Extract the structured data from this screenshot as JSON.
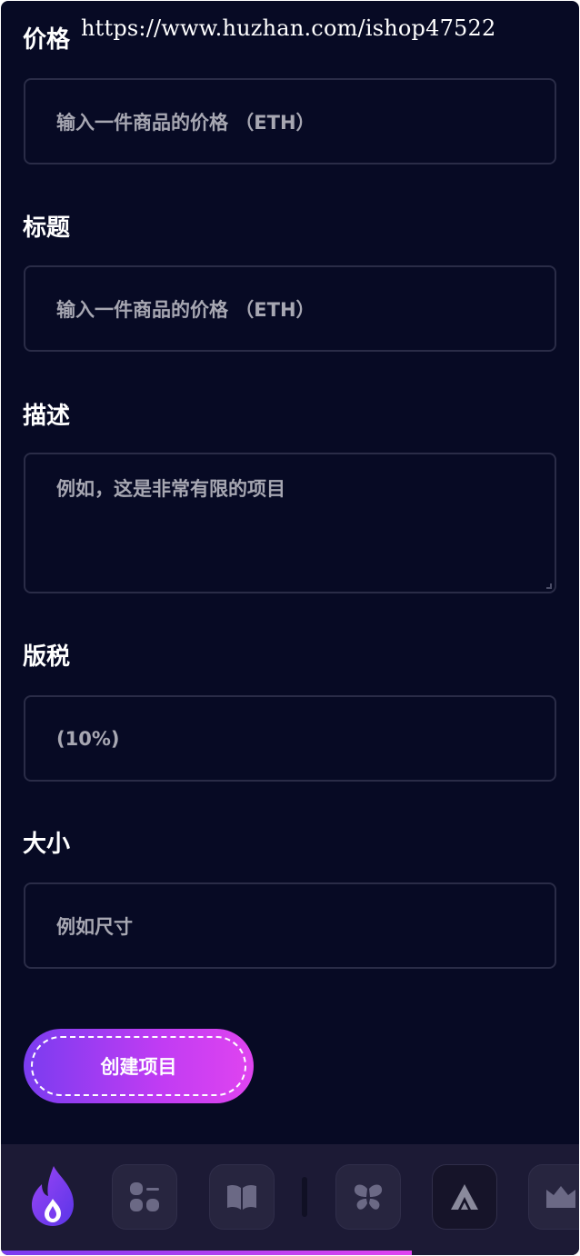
{
  "watermark": "https://www.huzhan.com/ishop47522",
  "form": {
    "price": {
      "label": "价格",
      "placeholder": "输入一件商品的价格 （ETH）"
    },
    "title": {
      "label": "标题",
      "placeholder": "输入一件商品的价格 （ETH）"
    },
    "description": {
      "label": "描述",
      "placeholder": "例如，这是非常有限的项目"
    },
    "royalty": {
      "label": "版税",
      "placeholder": "(10%)"
    },
    "size": {
      "label": "大小",
      "placeholder": "例如尺寸"
    },
    "submit_label": "创建项目"
  },
  "nav": {
    "items": [
      {
        "icon": "flame-logo-icon"
      },
      {
        "icon": "dashboard-grid-icon"
      },
      {
        "icon": "book-icon"
      },
      {
        "icon": "butterfly-icon"
      },
      {
        "icon": "triangle-a-icon"
      },
      {
        "icon": "crown-icon"
      }
    ],
    "progress": 0.71
  },
  "colors": {
    "background": "#070a24",
    "field_border": "#2a2c47",
    "accent_start": "#7a3cf0",
    "accent_end": "#e044f0",
    "bottom_bar": "#1c1a35"
  }
}
